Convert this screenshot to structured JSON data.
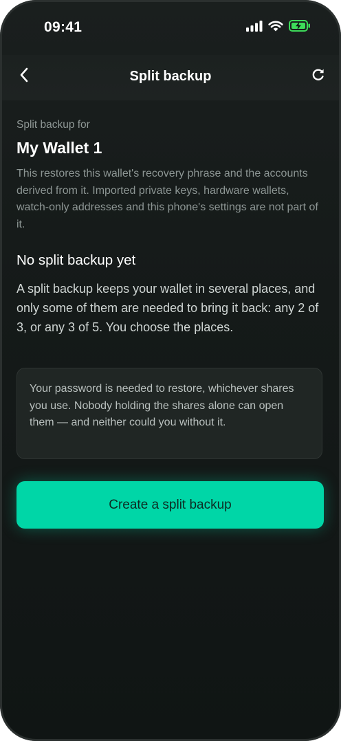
{
  "status_bar": {
    "time": "09:41",
    "icons": [
      "cellular-signal-icon",
      "wifi-icon",
      "battery-charging-icon"
    ]
  },
  "nav": {
    "title": "Split backup",
    "back_icon": "chevron-left-icon",
    "refresh_icon": "refresh-icon"
  },
  "wallet": {
    "eyebrow": "Split backup for",
    "name": "My Wallet 1",
    "scope_note": "This restores this wallet's recovery phrase and the accounts derived from it. Imported private keys, hardware wallets, watch-only addresses and this phone's settings are not part of it."
  },
  "empty_state": {
    "title": "No split backup yet",
    "body": "A split backup keeps your wallet in several places, and only some of them are needed to bring it back: any 2 of 3, or any 3 of 5. You choose the places."
  },
  "password_note": "Your password is needed to restore, whichever shares you use. Nobody holding the shares alone can open them — and neither could you without it.",
  "cta": {
    "label": "Create a split backup"
  },
  "colors": {
    "accent": "#00d6a7",
    "background": "#151a19",
    "battery": "#3ddc5a"
  }
}
